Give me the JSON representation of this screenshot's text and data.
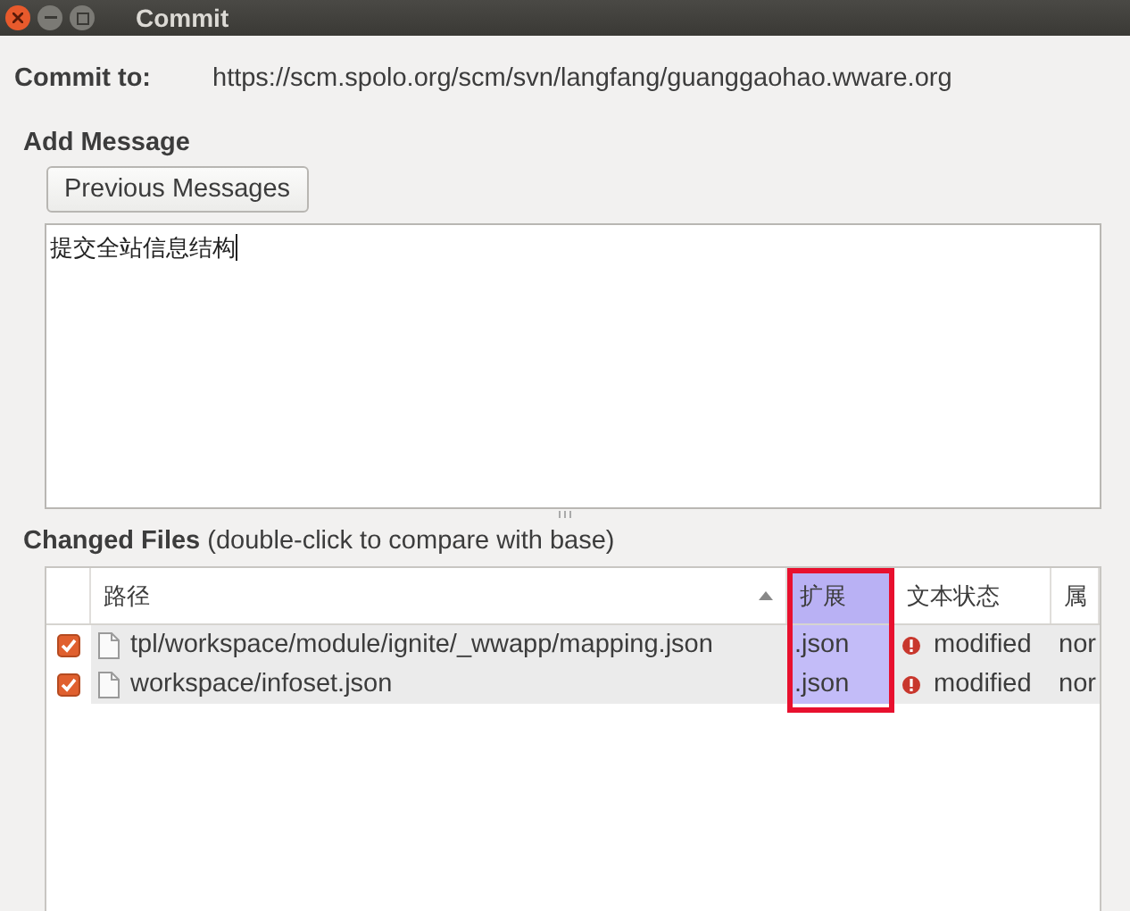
{
  "window": {
    "title": "Commit"
  },
  "commit_to": {
    "label": "Commit to:",
    "url": "https://scm.spolo.org/scm/svn/langfang/guanggaohao.wware.org"
  },
  "add_message": {
    "heading": "Add Message",
    "button": "Previous Messages",
    "message": "提交全站信息结构"
  },
  "changed_files": {
    "heading": "Changed Files",
    "hint": "(double-click to compare with base)",
    "columns": [
      {
        "label": "路径",
        "sorted": true,
        "highlighted": false
      },
      {
        "label": "扩展",
        "sorted": false,
        "highlighted": true
      },
      {
        "label": "文本状态",
        "sorted": false,
        "highlighted": false
      },
      {
        "label": "属",
        "sorted": false,
        "highlighted": false
      }
    ],
    "rows": [
      {
        "checked": true,
        "path": "tpl/workspace/module/ignite/_wwapp/mapping.json",
        "extension": ".json",
        "status": "modified",
        "column_4": "nor"
      },
      {
        "checked": true,
        "path": "workspace/infoset.json",
        "extension": ".json",
        "status": "modified",
        "column_4": "nor"
      }
    ]
  }
}
